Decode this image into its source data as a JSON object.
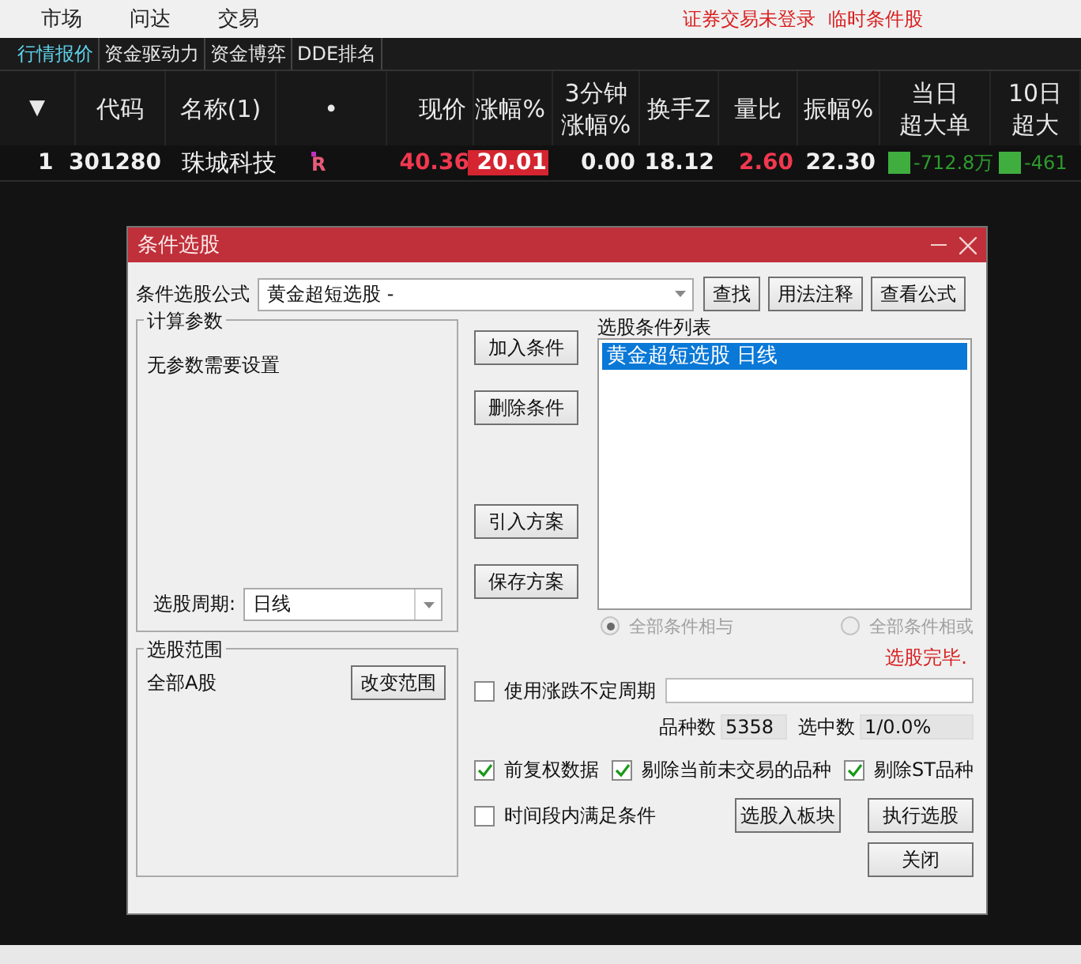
{
  "menu": {
    "items": [
      "市场",
      "问达",
      "交易"
    ],
    "notices": [
      "证券交易未登录",
      "临时条件股"
    ]
  },
  "tabs": [
    {
      "label": "行情报价",
      "selected": true
    },
    {
      "label": "资金驱动力",
      "selected": false
    },
    {
      "label": "资金博弈",
      "selected": false
    },
    {
      "label": "DDE排名",
      "selected": false
    }
  ],
  "table": {
    "columns": [
      {
        "kind": "sort",
        "label": "▼"
      },
      {
        "kind": "text",
        "label": [
          "代码"
        ]
      },
      {
        "kind": "text",
        "label": [
          "名称(1)"
        ]
      },
      {
        "kind": "text",
        "label": [
          "•"
        ]
      },
      {
        "kind": "text",
        "label": [
          "现价"
        ]
      },
      {
        "kind": "text",
        "label": [
          "涨幅%"
        ]
      },
      {
        "kind": "text",
        "label": [
          "3分钟",
          "涨幅%"
        ]
      },
      {
        "kind": "text",
        "label": [
          "换手Z"
        ]
      },
      {
        "kind": "text",
        "label": [
          "量比"
        ]
      },
      {
        "kind": "text",
        "label": [
          "振幅%"
        ]
      },
      {
        "kind": "text",
        "label": [
          "当日",
          "超大单"
        ]
      },
      {
        "kind": "text",
        "label": [
          "10日",
          "超大"
        ]
      }
    ],
    "rows": [
      {
        "cells": [
          {
            "kind": "text",
            "text": "1",
            "rising": false
          },
          {
            "kind": "text",
            "text": "301280",
            "rising": false
          },
          {
            "kind": "text",
            "text": "珠城科技",
            "rising": false
          },
          {
            "kind": "mark",
            "text": "R"
          },
          {
            "kind": "text",
            "text": "40.36",
            "rising": true
          },
          {
            "kind": "highlight",
            "text": "20.01"
          },
          {
            "kind": "text",
            "text": "0.00",
            "rising": false
          },
          {
            "kind": "text",
            "text": "18.12",
            "rising": false
          },
          {
            "kind": "text",
            "text": "2.60",
            "rising": true
          },
          {
            "kind": "text",
            "text": "22.30",
            "rising": false
          },
          {
            "kind": "flow",
            "text": "-712.8万"
          },
          {
            "kind": "flow",
            "text": "-461"
          }
        ]
      }
    ]
  },
  "dialog": {
    "title": "条件选股",
    "formula": {
      "label": "条件选股公式",
      "value": "黄金超短选股 -"
    },
    "top_buttons": [
      "查找",
      "用法注释",
      "查看公式"
    ],
    "params": {
      "title": "计算参数",
      "text": "无参数需要设置",
      "period_label": "选股周期:",
      "period_value": "日线"
    },
    "action_buttons": [
      "加入条件",
      "删除条件",
      "引入方案",
      "保存方案"
    ],
    "condition_list": {
      "title": "选股条件列表",
      "items": [
        {
          "text": "黄金超短选股  日线",
          "selected": true
        }
      ]
    },
    "radios": [
      {
        "label": "全部条件相与",
        "selected": true,
        "disabled": true
      },
      {
        "label": "全部条件相或",
        "selected": false,
        "disabled": true
      }
    ],
    "status": "选股完毕.",
    "range": {
      "title": "选股范围",
      "text": "全部A股",
      "button": "改变范围"
    },
    "variable_period": {
      "label": "使用涨跌不定周期",
      "checked": false
    },
    "counts": [
      {
        "label": "品种数",
        "value": "5358"
      },
      {
        "label": "选中数",
        "value": "1/0.0%"
      }
    ],
    "options": [
      {
        "label": "前复权数据",
        "checked": true
      },
      {
        "label": "剔除当前未交易的品种",
        "checked": true
      },
      {
        "label": "剔除ST品种",
        "checked": true
      }
    ],
    "time_range": {
      "label": "时间段内满足条件",
      "checked": false
    },
    "bottom_buttons": [
      "选股入板块",
      "执行选股"
    ],
    "close_button": "关闭"
  }
}
